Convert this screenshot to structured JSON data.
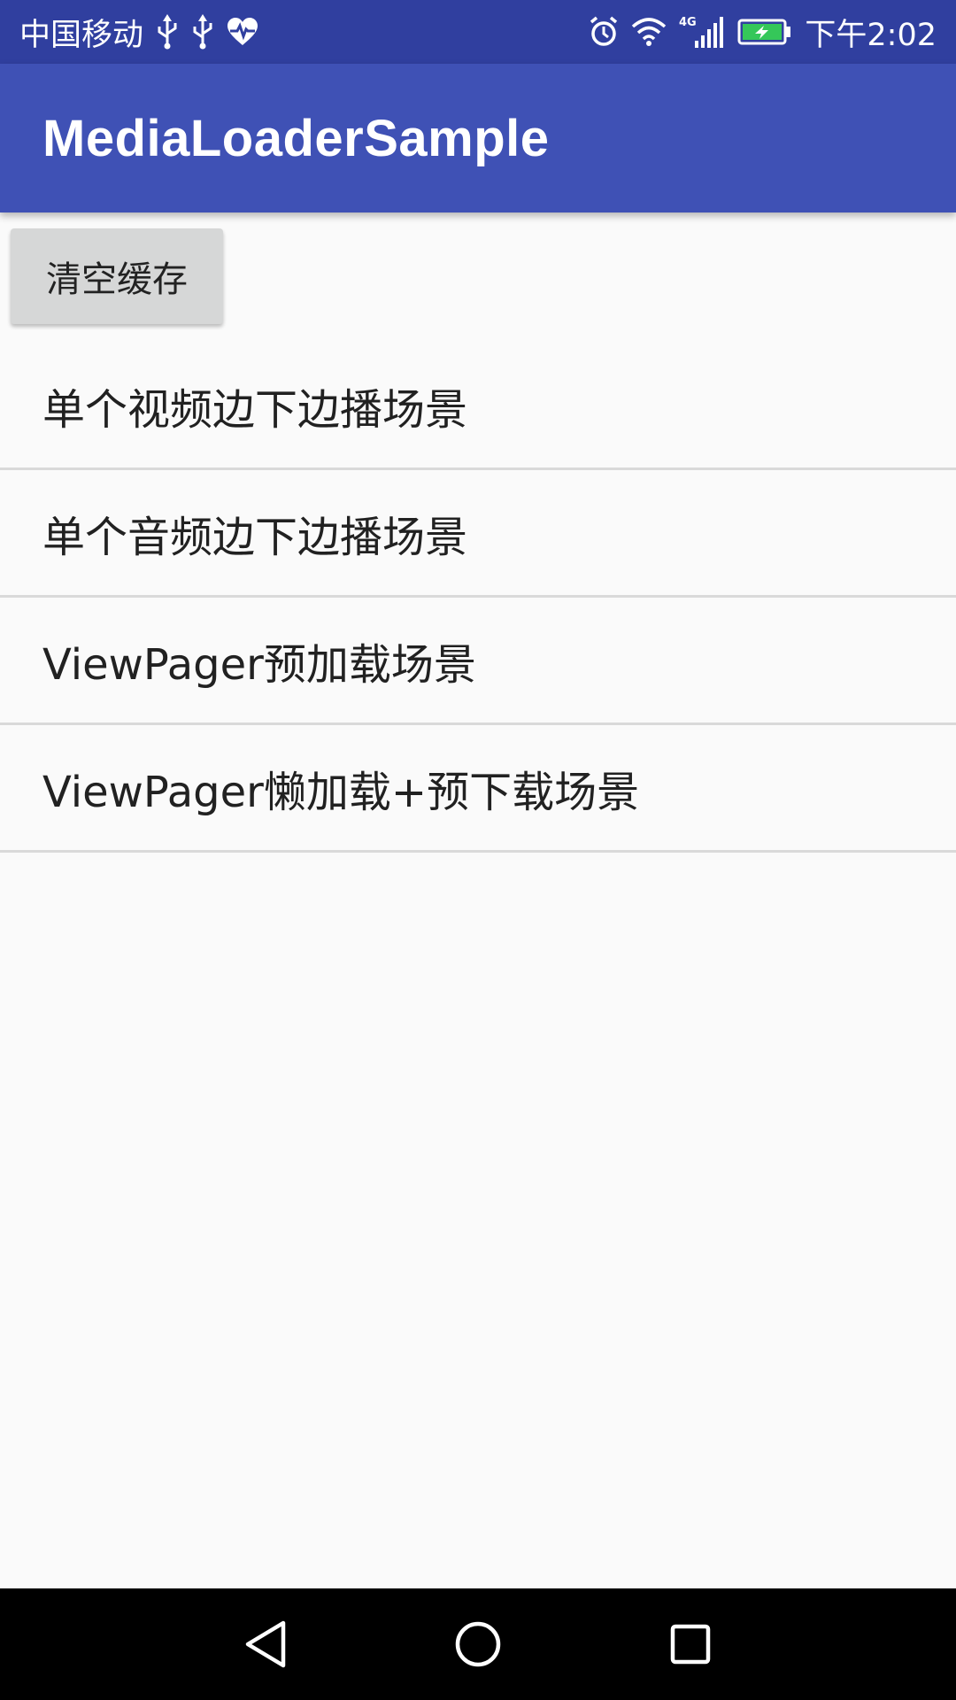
{
  "status_bar": {
    "carrier": "中国移动",
    "network_type": "4G",
    "time": "下午2:02",
    "left_icons": [
      "usb-icon",
      "usb-icon",
      "health-heart-icon"
    ],
    "right_icons": [
      "alarm-icon",
      "wifi-icon",
      "cell-signal-icon",
      "battery-charging-icon"
    ],
    "battery_color": "#35c759"
  },
  "app_bar": {
    "title": "MediaLoaderSample",
    "color": "#3f51b5",
    "status_color": "#303f9f"
  },
  "clear_button": {
    "label": "清空缓存"
  },
  "list": {
    "items": [
      {
        "label": "单个视频边下边播场景"
      },
      {
        "label": "单个音频边下边播场景"
      },
      {
        "label": "ViewPager预加载场景"
      },
      {
        "label": "ViewPager懒加载+预下载场景"
      }
    ]
  },
  "nav_bar": {
    "buttons": [
      "back-icon",
      "home-icon",
      "recents-icon"
    ]
  }
}
